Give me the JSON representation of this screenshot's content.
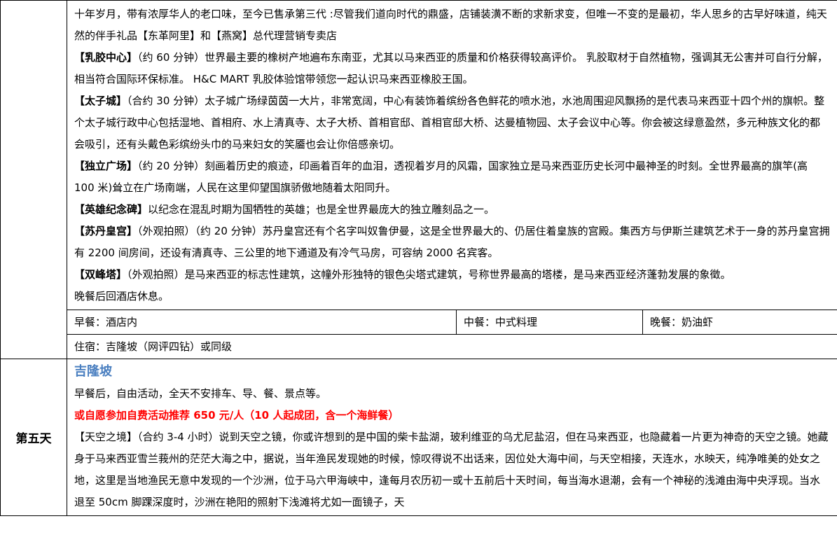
{
  "day4": {
    "intro": "十年岁月，带有浓厚华人的老口味，至今已售承第三代 :尽管我们道向时代的鼎盛，店铺装潢不断的求新求变，但唯一不变的是最初，华人思乡的古早好味道，纯天然的伴手礼品【东革阿里】和【燕窝】总代理营销专卖店",
    "items": [
      {
        "label": "【乳胶中心】",
        "text": "（约 60 分钟）世界最主要的橡树产地遍布东南亚，尤其以马来西亚的质量和价格获得较高评价。 乳胶取材于自然植物，强调其无公害并可自行分解， 相当符合国际环保标准。 H&C MART 乳胶体验馆带领您一起认识马来西亚橡胶王国。"
      },
      {
        "label": "【太子城】",
        "text": "（合约 30 分钟）太子城广场绿茵茵一大片，非常宽阔，中心有装饰着缤纷各色鲜花的喷水池，水池周围迎风飘扬的是代表马来西亚十四个州的旗帜。整个太子城行政中心包括湿地、首相府、水上清真寺、太子大桥、首相官邸、首相官邸大桥、达曼植物园、太子会议中心等。你会被这绿意盈然，多元种族文化的都会吸引，还有头戴色彩缤纷头巾的马来妇女的笑靥也会让你倍感亲切。"
      },
      {
        "label": "【独立广场】",
        "text": "（约 20 分钟）刻画着历史的痕迹，印画着百年的血泪，透视着岁月的风霜，国家独立是马来西亚历史长河中最神圣的时刻。全世界最高的旗竿(高 100 米)耸立在广场南端，人民在这里仰望国旗骄傲地随着太阳同升。"
      },
      {
        "label": "【英雄纪念碑】",
        "text": "以纪念在混乱时期为国牺牲的英雄；也是全世界最庞大的独立雕刻品之一。"
      },
      {
        "label": "【苏丹皇宫】",
        "text": "（外观拍照）（约 20 分钟）苏丹皇宫还有个名字叫奴鲁伊曼，这是全世界最大的、仍居住着皇族的宫殿。集西方与伊斯兰建筑艺术于一身的苏丹皇宫拥有 2200 间房间，还设有清真寺、三公里的地下通道及有冷气马房，可容纳 2000 名宾客。"
      },
      {
        "label": "【双峰塔】",
        "text": "（外观拍照）是马来西亚的标志性建筑，这幢外形独特的银色尖塔式建筑，号称世界最高的塔楼，是马来西亚经济蓬勃发展的象徵。"
      }
    ],
    "evening": "晚餐后回酒店休息。",
    "breakfast": "早餐：酒店内",
    "lunch": "中餐：中式料理",
    "dinner": "晚餐：奶油虾",
    "hotel": "住宿：吉隆坡（网评四钻）或同级"
  },
  "day5": {
    "label": "第五天",
    "city": "吉隆坡",
    "free": "早餐后，自由活动，全天不安排车、导、餐、景点等。",
    "optional": "或自愿参加自费活动推荐 650 元/人（10 人起成团，含一个海鲜餐）",
    "sky_label": "【天空之境】",
    "sky_text": "（合约 3-4 小时）说到天空之镜，你或许想到的是中国的柴卡盐湖，玻利维亚的乌尤尼盐沼，但在马来西亚，也隐藏着一片更为神奇的天空之镜。她藏身于马来西亚雪兰莪州的茫茫大海之中，据说，当年渔民发现她的时候，惊叹得说不出话来，因位处大海中间，与天空相接，天连水，水映天，纯净唯美的处女之地，这里是当地渔民无意中发现的一个沙洲，位于马六甲海峡中，逢每月农历初一或十五前后十天时间，每当海水退潮，会有一个神秘的浅滩由海中央浮现。当水退至 50cm 脚踝深度时，沙洲在艳阳的照射下浅滩将尤如一面镜子，天"
  }
}
